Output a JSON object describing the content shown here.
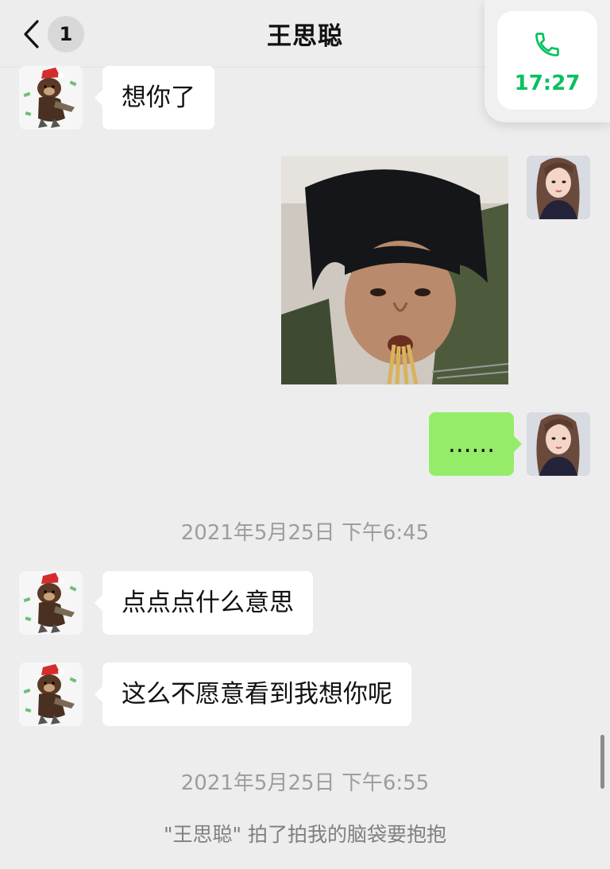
{
  "header": {
    "title": "王思聪",
    "unread_count": "1",
    "back_icon": "chevron-left-icon"
  },
  "call_float": {
    "icon": "phone-icon",
    "time": "17:27",
    "accent": "#07c160"
  },
  "messages": [
    {
      "sender": "contact",
      "type": "text",
      "text": "想你了"
    },
    {
      "sender": "me",
      "type": "sticker",
      "description_icon": "sticker-image"
    },
    {
      "sender": "me",
      "type": "text",
      "text": "......"
    },
    {
      "sender": "contact",
      "type": "text",
      "text": "点点点什么意思"
    },
    {
      "sender": "contact",
      "type": "text",
      "text": "这么不愿意看到我想你呢"
    }
  ],
  "timestamps": [
    "2021年5月25日 下午6:45",
    "2021年5月25日 下午6:55"
  ],
  "system_note": "\"王思聪\" 拍了拍我的脑袋要抱抱",
  "colors": {
    "background": "#ededed",
    "incoming_bubble": "#ffffff",
    "outgoing_bubble": "#95ec69"
  }
}
